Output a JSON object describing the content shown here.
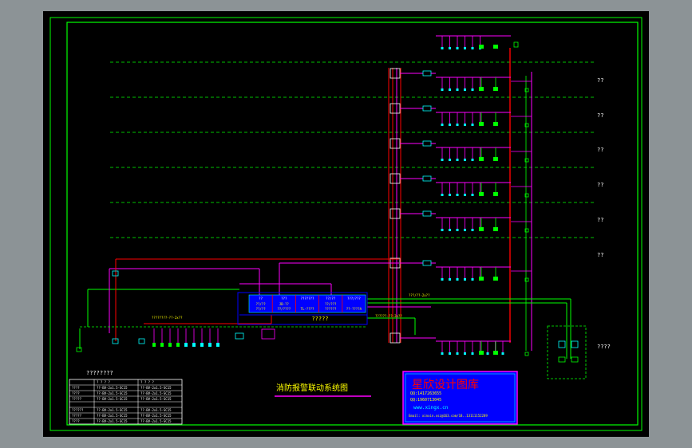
{
  "drawing": {
    "title": "消防报警联动系统图",
    "floor_labels": [
      "??",
      "??",
      "??",
      "??",
      "??",
      "??",
      "??"
    ],
    "bottom_right_label": "????",
    "controller_caption": "?????",
    "legend_title": "????????"
  },
  "controller": {
    "modules": [
      {
        "name": "??",
        "lines": [
          "??/??",
          "??/??"
        ]
      },
      {
        "name": "???",
        "lines": [
          "JB-??",
          "??/????"
        ]
      },
      {
        "name": "???????",
        "lines": [
          "",
          "TL-????"
        ]
      },
      {
        "name": "??/??",
        "lines": [
          "??/???",
          "??????"
        ]
      },
      {
        "name": "???/???",
        "lines": [
          "",
          "??-????A"
        ]
      }
    ]
  },
  "wire_labels": [
    "???/??-2x??",
    "??????-??-2x??",
    "????????-??-2x??"
  ],
  "legend_table": {
    "header": [
      "",
      "? ? ? ?",
      "? ? ? ?"
    ],
    "rows": [
      [
        "????",
        "??-BV-2x1.5-SC15",
        "??-BV-2x1.5-SC15"
      ],
      [
        "????",
        "??-BV-2x1.5-SC15",
        "??-BV-2x1.5-SC15"
      ],
      [
        "?????",
        "??-BV-2x1.5-SC15",
        "??-BV-2x1.5-SC15"
      ],
      [
        "",
        "",
        ""
      ],
      [
        "??????",
        "??-BV-2x1.5-SC15",
        "??-BV-2x1.5-SC15"
      ],
      [
        "?????",
        "??-BV-2x1.5-SC15",
        "??-BV-2x1.5-SC15"
      ],
      [
        "????",
        "??-BV-2x1.5-SC15",
        "??-BV-2x1.5-SC15"
      ]
    ]
  },
  "watermark": {
    "brand": "星欣设计图库",
    "qq1": "QQ:1417263655",
    "qq2": "QQ:1960713045",
    "url": "www.xingx.cn",
    "email": "Email: xinxin.xsz@163.com/18..13111152289"
  },
  "colors": {
    "page_bg": "#8c9396",
    "canvas_bg": "#000000",
    "frame": "#00ff00",
    "riser_red": "#ff0000",
    "bus_magenta": "#ff00ff",
    "device_green": "#00ff00",
    "device_cyan": "#00ffff",
    "accent_blue": "#0000ff",
    "text_white": "#ffffff",
    "text_yellow": "#ffff00"
  }
}
